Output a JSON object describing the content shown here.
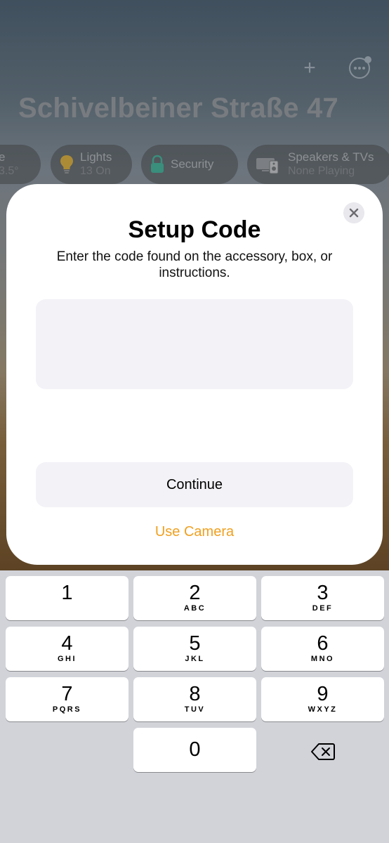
{
  "home": {
    "title": "Schivelbeiner Straße 47",
    "chips": [
      {
        "title": "e",
        "sub": "3.5°",
        "icon": "thermometer-icon"
      },
      {
        "title": "Lights",
        "sub": "13 On",
        "icon": "lightbulb-icon"
      },
      {
        "title": "Security",
        "sub": "",
        "icon": "lock-icon"
      },
      {
        "title": "Speakers & TVs",
        "sub": "None Playing",
        "icon": "speaker-tv-icon"
      }
    ]
  },
  "modal": {
    "title": "Setup Code",
    "subtitle": "Enter the code found on the accessory, box, or instructions.",
    "code_value": "",
    "continue_label": "Continue",
    "camera_label": "Use Camera"
  },
  "keypad": {
    "keys": [
      {
        "num": "1",
        "letters": ""
      },
      {
        "num": "2",
        "letters": "ABC"
      },
      {
        "num": "3",
        "letters": "DEF"
      },
      {
        "num": "4",
        "letters": "GHI"
      },
      {
        "num": "5",
        "letters": "JKL"
      },
      {
        "num": "6",
        "letters": "MNO"
      },
      {
        "num": "7",
        "letters": "PQRS"
      },
      {
        "num": "8",
        "letters": "TUV"
      },
      {
        "num": "9",
        "letters": "WXYZ"
      },
      {
        "num": "0",
        "letters": ""
      }
    ]
  },
  "colors": {
    "accent": "#f0a020",
    "field_bg": "#f2f2f7",
    "keyboard_bg": "#d1d3d9"
  }
}
